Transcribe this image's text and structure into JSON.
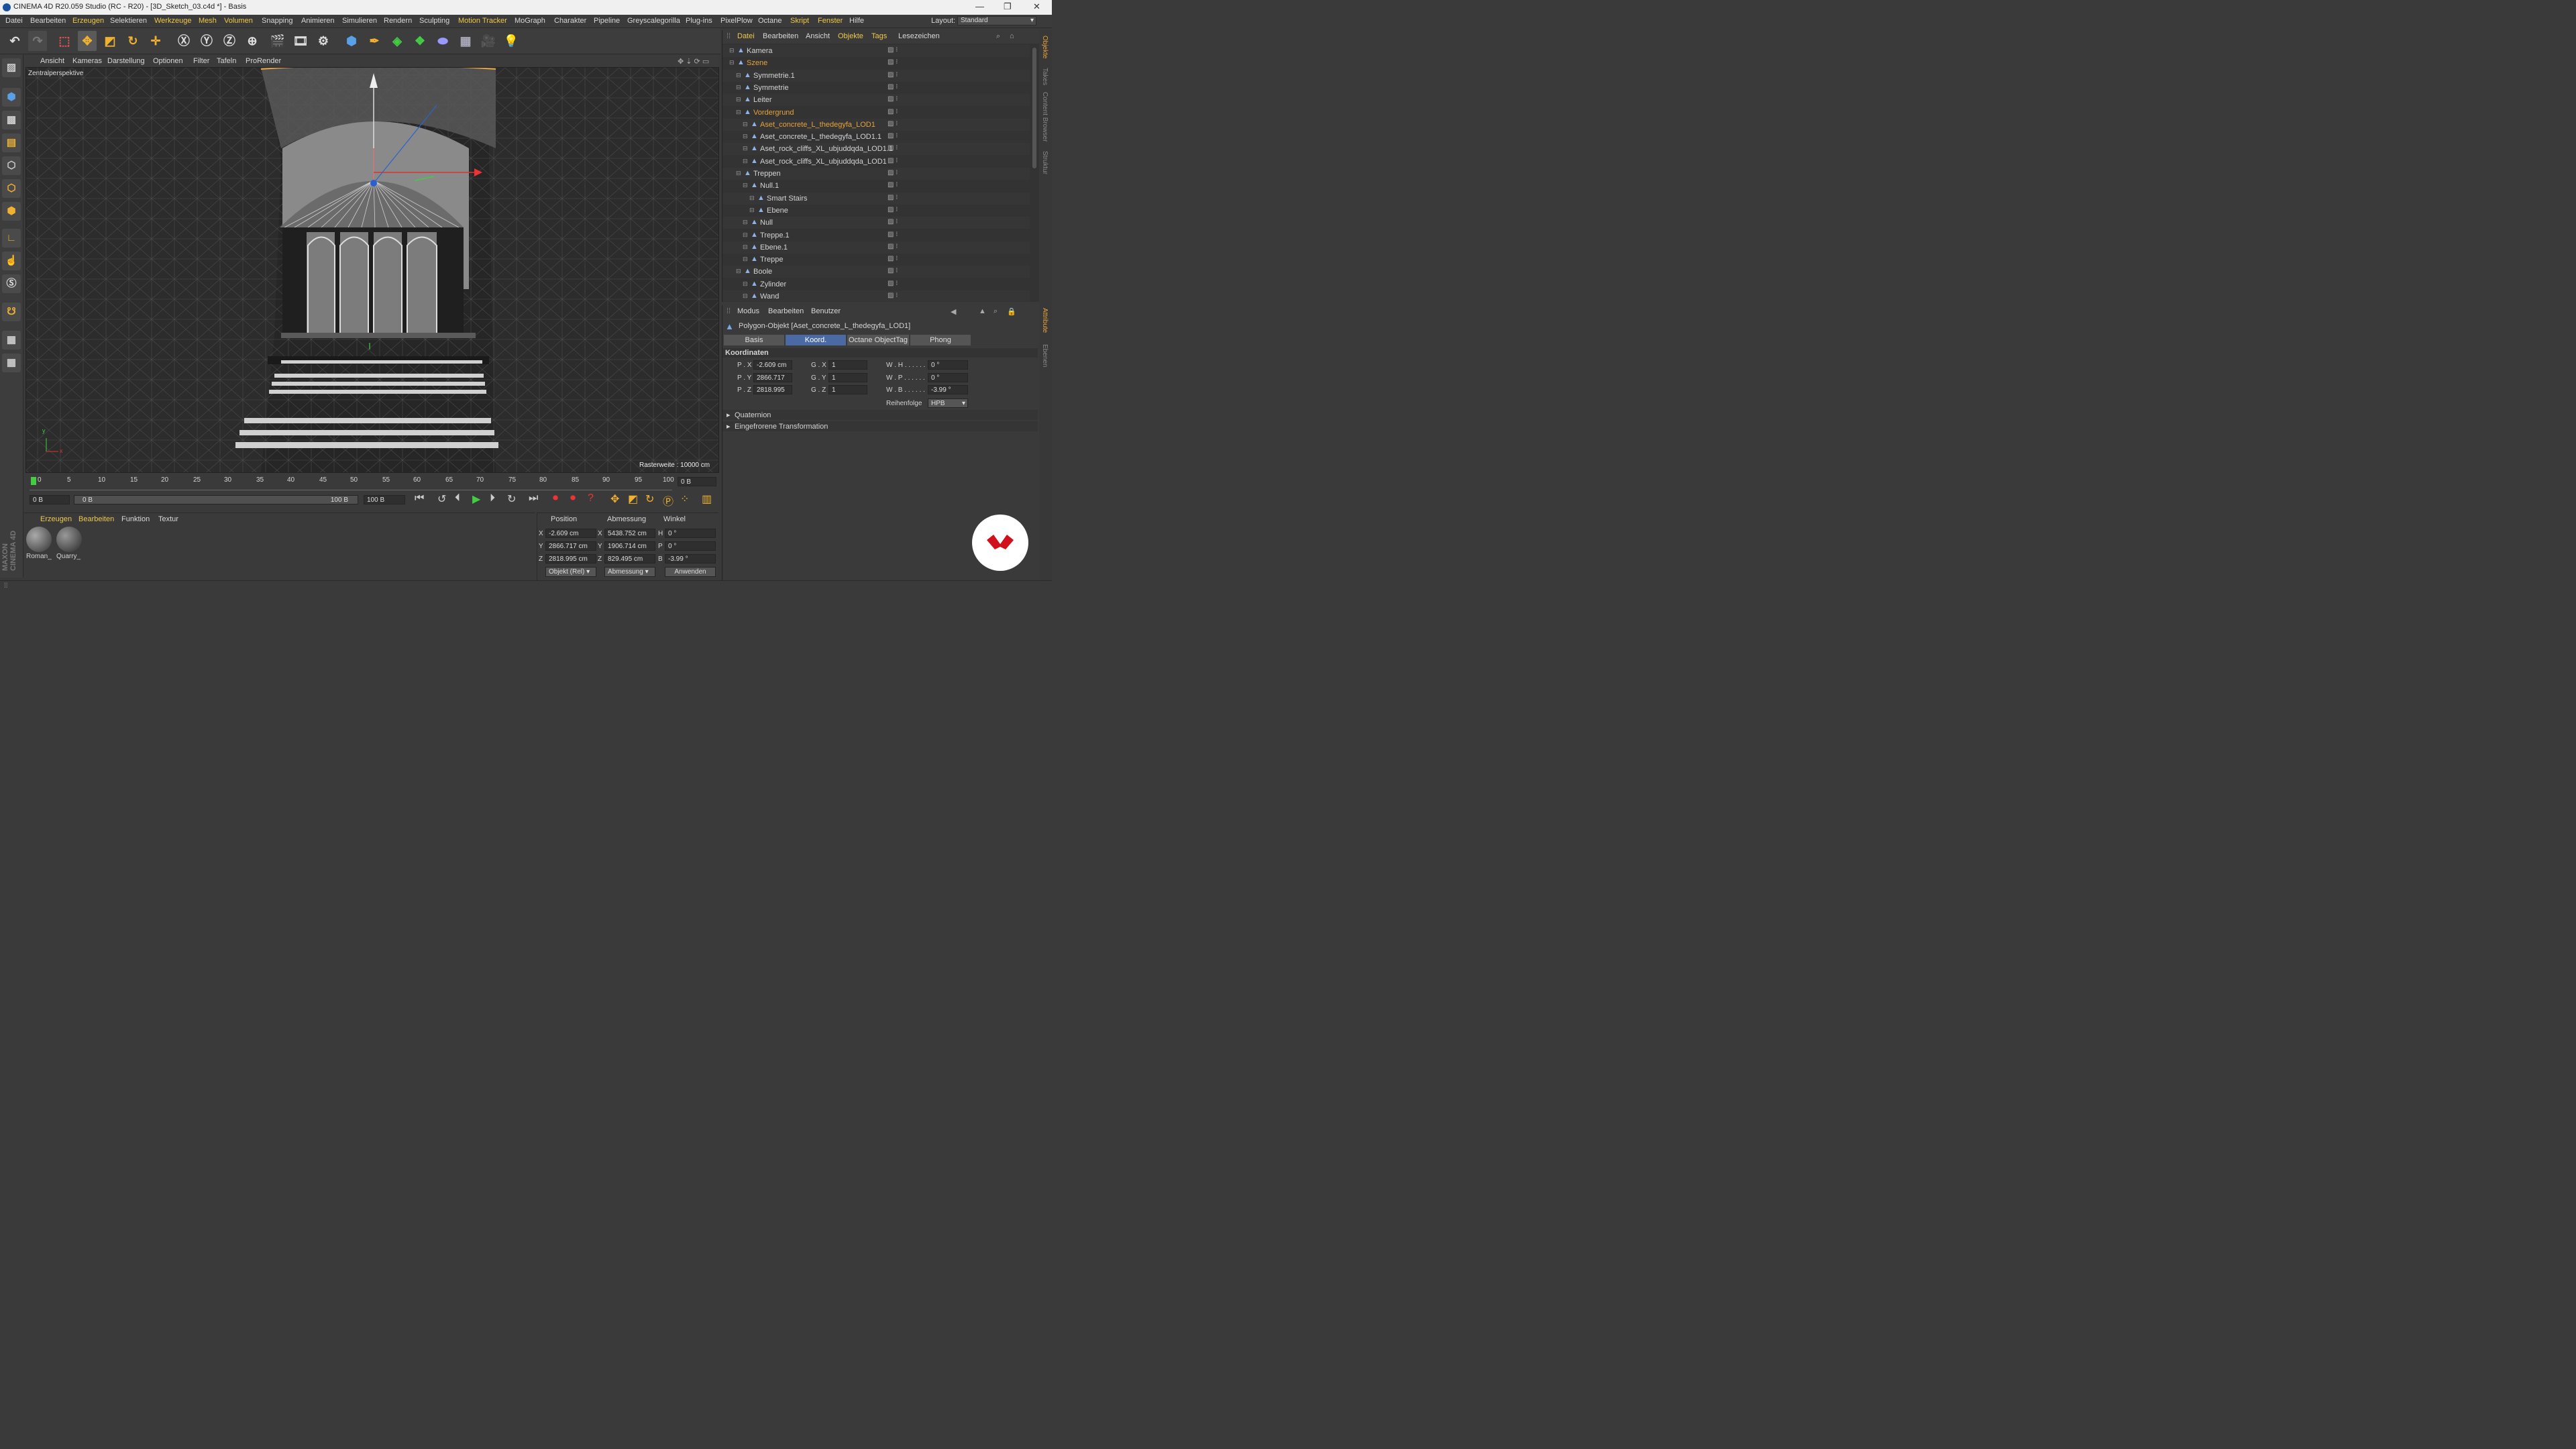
{
  "window": {
    "title": "CINEMA 4D R20.059 Studio (RC - R20) - [3D_Sketch_03.c4d *] - Basis",
    "min": "—",
    "max": "❐",
    "close": "✕"
  },
  "menubar": {
    "items": [
      "Datei",
      "Bearbeiten",
      "Erzeugen",
      "Selektieren",
      "Werkzeuge",
      "Mesh",
      "Volumen",
      "Snapping",
      "Animieren",
      "Simulieren",
      "Rendern",
      "Sculpting",
      "Motion Tracker",
      "MoGraph",
      "Charakter",
      "Pipeline",
      "Greyscalegorilla",
      "Plug-ins",
      "PixelPlow",
      "Octane",
      "Skript",
      "Fenster",
      "Hilfe"
    ],
    "layout_label": "Layout:",
    "layout_value": "Standard"
  },
  "viewport": {
    "menu": [
      "Ansicht",
      "Kameras",
      "Darstellung",
      "Optionen",
      "Filter",
      "Tafeln",
      "ProRender"
    ],
    "camera_label": "Zentralperspektive",
    "grid_label": "Rasterweite : 10000 cm",
    "axis_y": "y",
    "axis_x": "x"
  },
  "timeline": {
    "ticks": [
      "0",
      "5",
      "10",
      "15",
      "20",
      "25",
      "30",
      "35",
      "40",
      "45",
      "50",
      "55",
      "60",
      "65",
      "70",
      "75",
      "80",
      "85",
      "90",
      "95",
      "100"
    ],
    "current_frame": "0 B",
    "start_field": "0 B",
    "range_start": "0 B",
    "range_end": "100 B",
    "end_field": "100 B"
  },
  "material_manager": {
    "menu": [
      "Erzeugen",
      "Bearbeiten",
      "Funktion",
      "Textur"
    ],
    "materials": [
      "Roman_",
      "Quarry_"
    ]
  },
  "coord_manager": {
    "headers": [
      "Position",
      "Abmessung",
      "Winkel"
    ],
    "rows": [
      {
        "axis": "X",
        "pos": "-2.609 cm",
        "size_axis": "X",
        "size": "5438.752 cm",
        "rot_axis": "H",
        "rot": "0 °"
      },
      {
        "axis": "Y",
        "pos": "2866.717 cm",
        "size_axis": "Y",
        "size": "1906.714 cm",
        "rot_axis": "P",
        "rot": "0 °"
      },
      {
        "axis": "Z",
        "pos": "2818.995 cm",
        "size_axis": "Z",
        "size": "829.495 cm",
        "rot_axis": "B",
        "rot": "-3.99 °"
      }
    ],
    "mode_dropdown": "Objekt (Rel)",
    "size_dropdown": "Abmessung",
    "apply_button": "Anwenden"
  },
  "object_manager": {
    "menu": [
      "Datei",
      "Bearbeiten",
      "Ansicht",
      "Objekte",
      "Tags",
      "Lesezeichen"
    ],
    "rows": [
      {
        "name": "Kamera",
        "indent": 0,
        "orange": false
      },
      {
        "name": "Szene",
        "indent": 0,
        "orange": true
      },
      {
        "name": "Symmetrie.1",
        "indent": 1,
        "orange": false
      },
      {
        "name": "Symmetrie",
        "indent": 1,
        "orange": false
      },
      {
        "name": "Leiter",
        "indent": 1,
        "orange": false
      },
      {
        "name": "Vordergrund",
        "indent": 1,
        "orange": true
      },
      {
        "name": "Aset_concrete_L_thedegyfa_LOD1",
        "indent": 2,
        "orange": true
      },
      {
        "name": "Aset_concrete_L_thedegyfa_LOD1.1",
        "indent": 2,
        "orange": false
      },
      {
        "name": "Aset_rock_cliffs_XL_ubjuddqda_LOD1.1",
        "indent": 2,
        "orange": false
      },
      {
        "name": "Aset_rock_cliffs_XL_ubjuddqda_LOD1",
        "indent": 2,
        "orange": false
      },
      {
        "name": "Treppen",
        "indent": 1,
        "orange": false
      },
      {
        "name": "Null.1",
        "indent": 2,
        "orange": false
      },
      {
        "name": "Smart Stairs",
        "indent": 3,
        "orange": false
      },
      {
        "name": "Ebene",
        "indent": 3,
        "orange": false
      },
      {
        "name": "Null",
        "indent": 2,
        "orange": false
      },
      {
        "name": "Treppe.1",
        "indent": 2,
        "orange": false
      },
      {
        "name": "Ebene.1",
        "indent": 2,
        "orange": false
      },
      {
        "name": "Treppe",
        "indent": 2,
        "orange": false
      },
      {
        "name": "Boole",
        "indent": 1,
        "orange": false
      },
      {
        "name": "Zylinder",
        "indent": 2,
        "orange": false
      },
      {
        "name": "Wand",
        "indent": 2,
        "orange": false
      }
    ]
  },
  "attribute_manager": {
    "menu": [
      "Modus",
      "Bearbeiten",
      "Benutzer"
    ],
    "object_title": "Polygon-Objekt [Aset_concrete_L_thedegyfa_LOD1]",
    "tabs": [
      "Basis",
      "Koord.",
      "Octane ObjectTag",
      "Phong"
    ],
    "active_tab": "Koord.",
    "section": "Koordinaten",
    "fields": [
      {
        "label": "P . X",
        "value": "-2.609 cm",
        "s_label": "G . X",
        "s_value": "1",
        "r_label": "W . H . . . . . .",
        "r_value": "0 °"
      },
      {
        "label": "P . Y",
        "value": "2866.717",
        "s_label": "G . Y",
        "s_value": "1",
        "r_label": "W . P . . . . . .",
        "r_value": "0 °"
      },
      {
        "label": "P . Z",
        "value": "2818.995",
        "s_label": "G . Z",
        "s_value": "1",
        "r_label": "W . B . . . . . .",
        "r_value": "-3.99 °"
      }
    ],
    "order_label": "Reihenfolge",
    "order_value": "HPB",
    "collapsed": [
      "Quaternion",
      "Eingefrorene Transformation"
    ]
  },
  "right_tabs": [
    "Objekte",
    "Takes",
    "Content Browser",
    "Struktur",
    "Attribute",
    "Ebenen"
  ],
  "colors": {
    "accent_orange": "#e8a23a",
    "active_tab": "#4b6aa3",
    "brand_red": "#d0111b"
  }
}
